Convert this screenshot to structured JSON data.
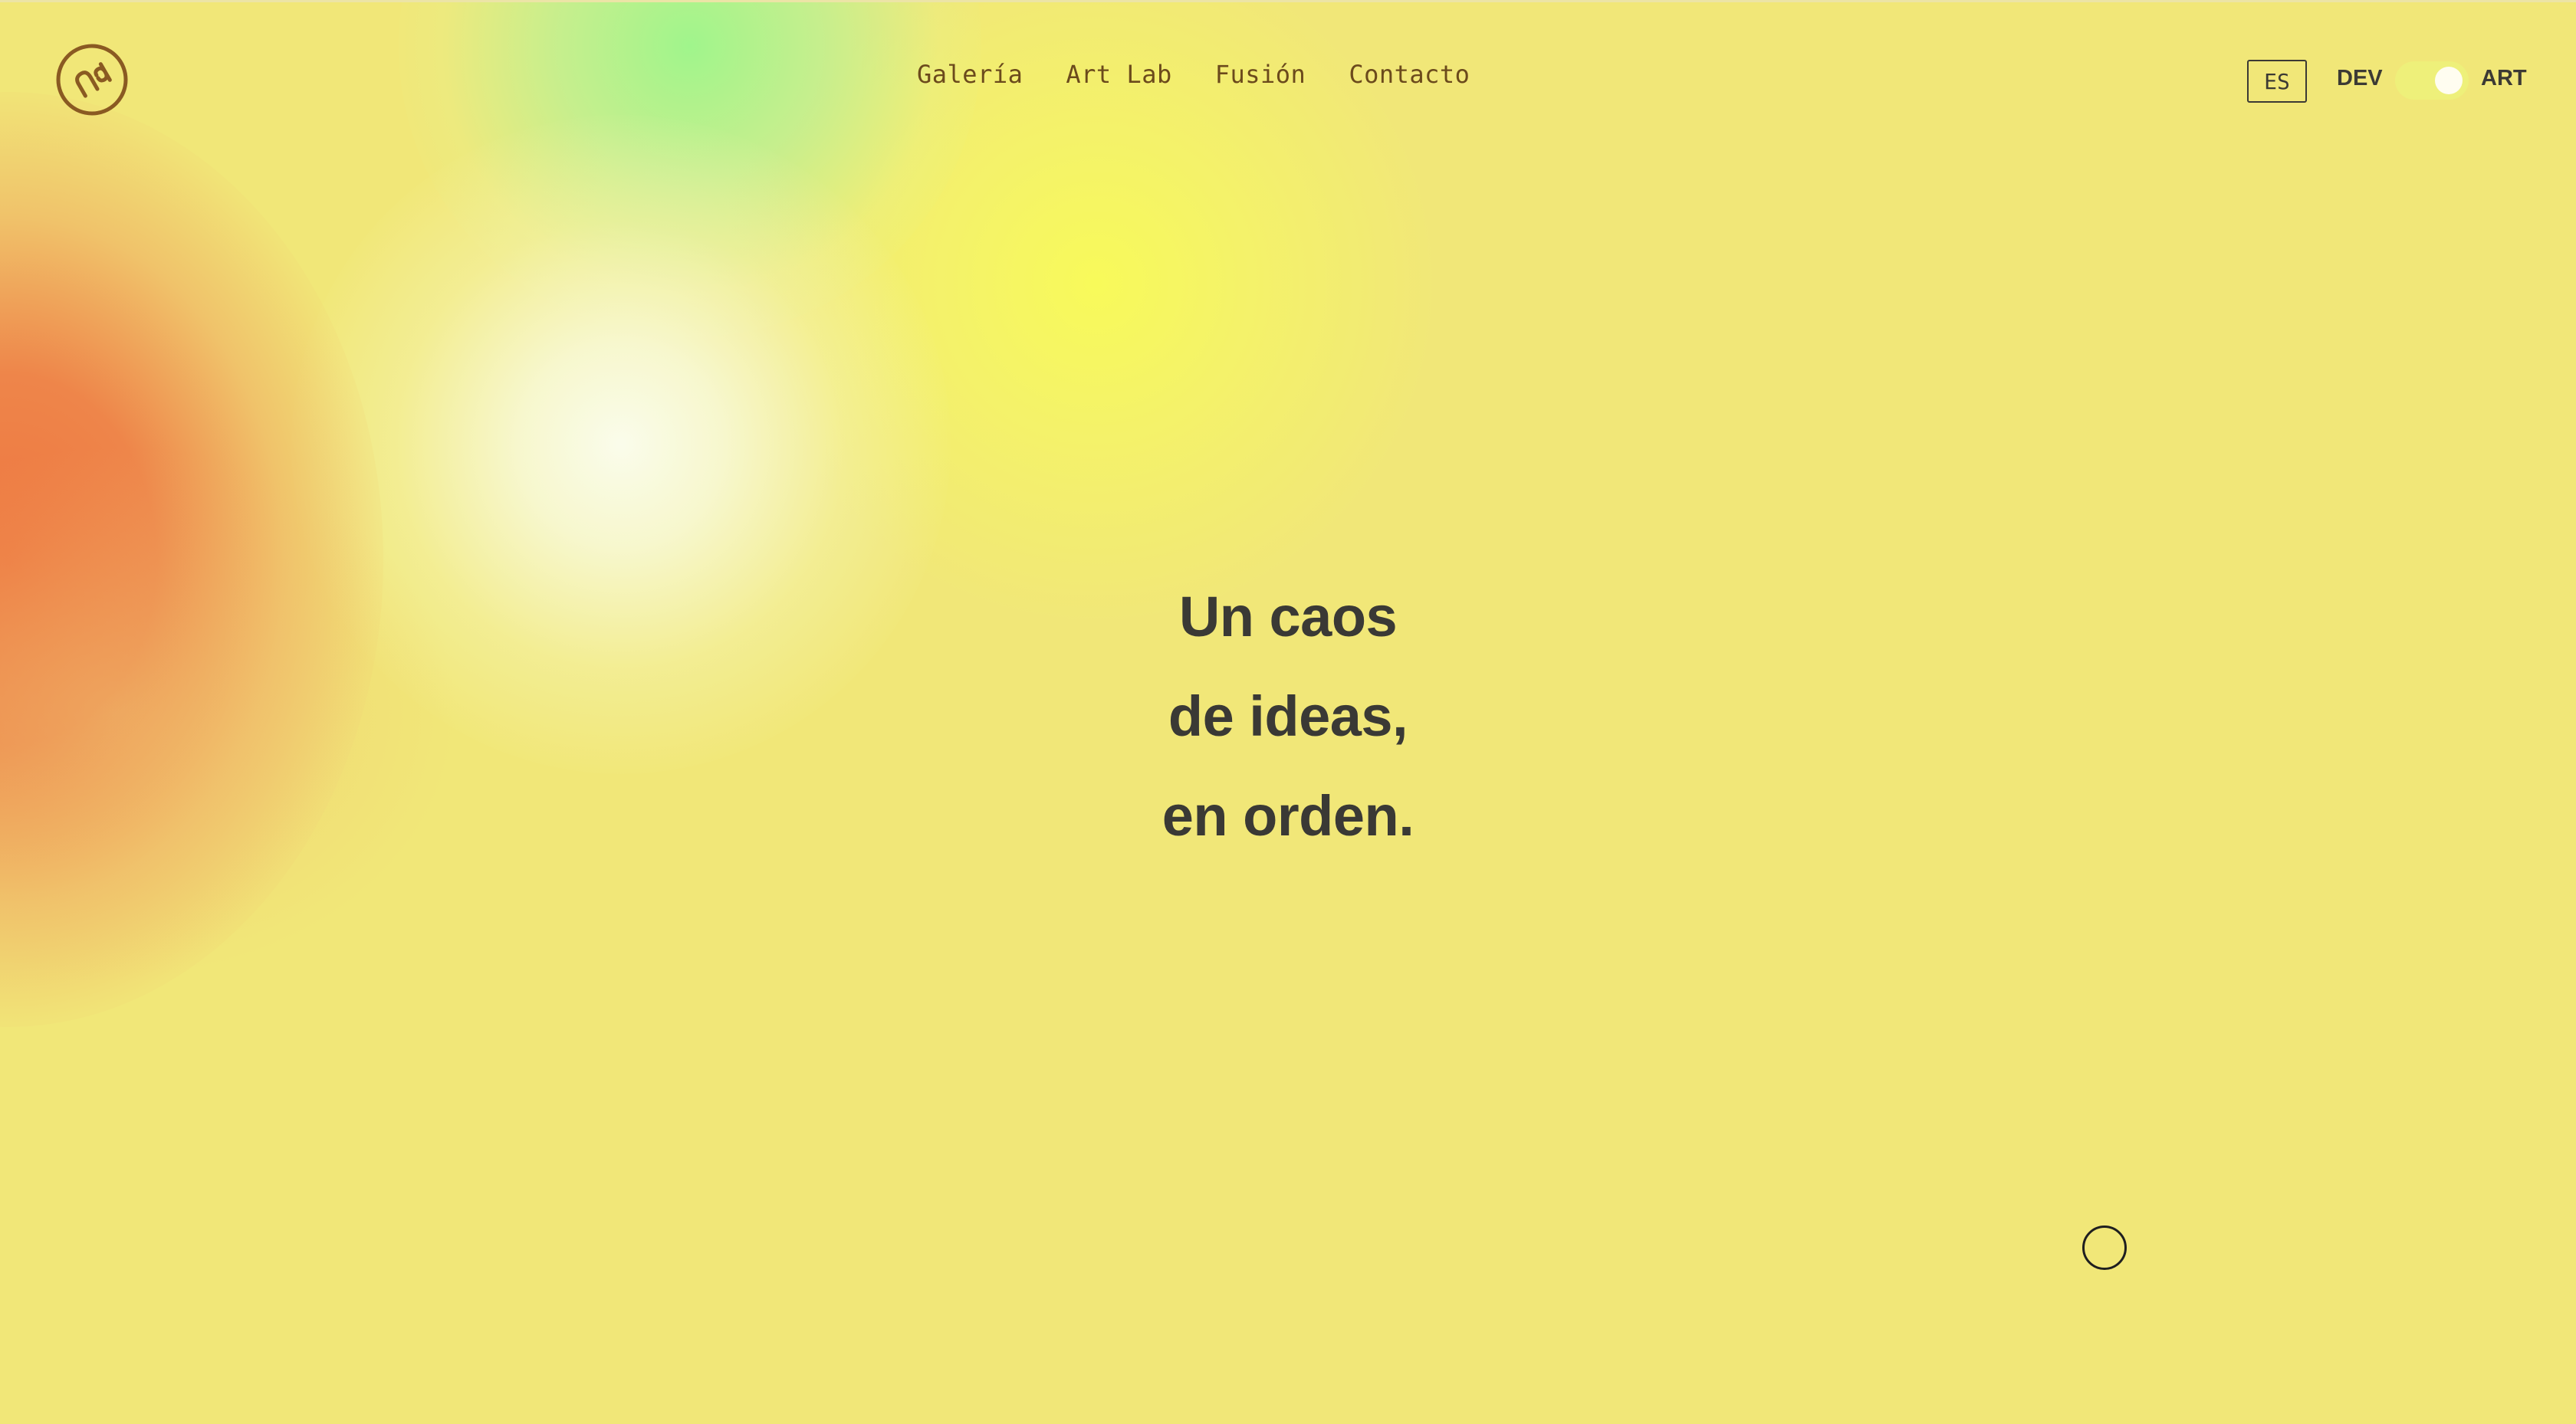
{
  "brand": {
    "logo_icon": "nd-circle-logo",
    "accent_color": "#8a5a22"
  },
  "nav": {
    "items": [
      {
        "label": "Galería"
      },
      {
        "label": "Art Lab"
      },
      {
        "label": "Fusión"
      },
      {
        "label": "Contacto"
      }
    ]
  },
  "header": {
    "language_label": "ES",
    "mode_left_label": "DEV",
    "mode_right_label": "ART",
    "mode_selected": "ART"
  },
  "hero": {
    "lines": [
      "Un caos",
      "de ideas,",
      "en orden."
    ]
  },
  "colors": {
    "background": "#f1e778",
    "text": "#3a3935",
    "nav_text": "#6b4a1c",
    "blob_orange": "#ee7640",
    "blob_green": "#a0f58c",
    "blob_white": "#fafceb"
  },
  "cursor_icon": "circle-cursor-icon"
}
